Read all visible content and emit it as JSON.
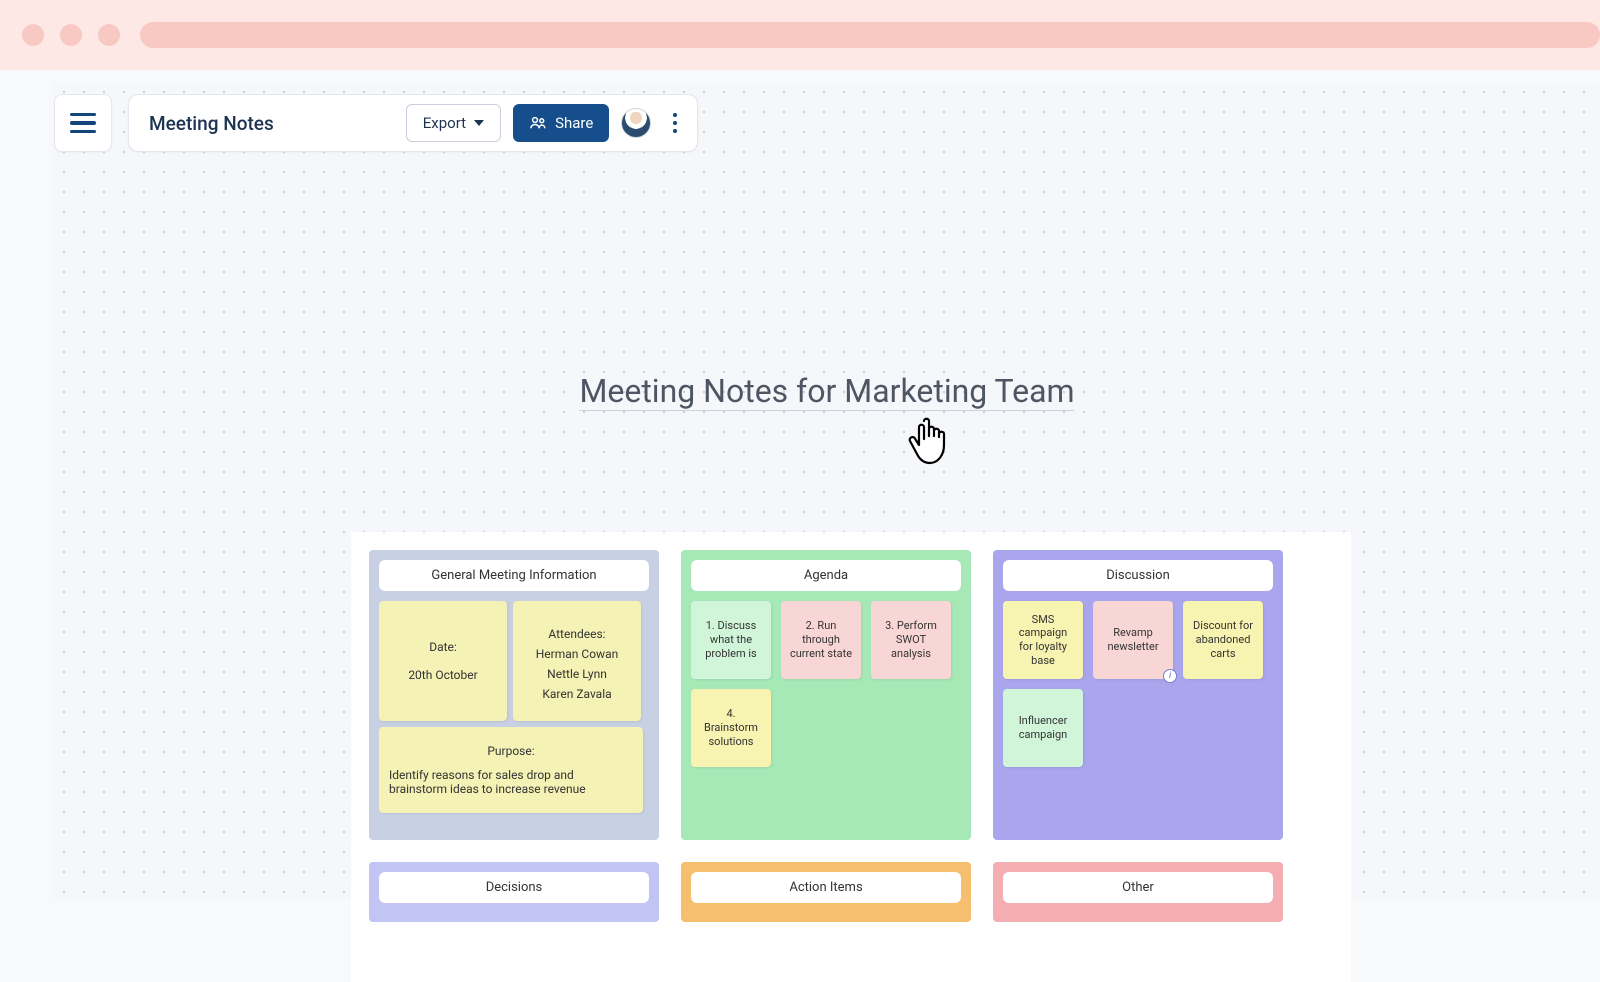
{
  "toolbar": {
    "doc_title": "Meeting Notes",
    "export_label": "Export",
    "share_label": "Share"
  },
  "board": {
    "title": "Meeting Notes for Marketing Team",
    "columns": {
      "general": {
        "header": "General Meeting Information",
        "date_label": "Date:",
        "date_value": "20th October",
        "attendees_label": "Attendees:",
        "attendees": [
          "Herman Cowan",
          "Nettle Lynn",
          "Karen Zavala"
        ],
        "purpose_label": "Purpose:",
        "purpose_text": "Identify reasons for sales drop and brainstorm ideas to increase revenue"
      },
      "agenda": {
        "header": "Agenda",
        "items": [
          "1. Discuss what the problem is",
          "2. Run through current state",
          "3. Perform SWOT analysis",
          "4. Brainstorm solutions"
        ]
      },
      "discussion": {
        "header": "Discussion",
        "items": [
          "SMS campaign for loyalty base",
          "Revamp newsletter",
          "Discount for abandoned carts",
          "Influencer campaign"
        ]
      },
      "decisions": {
        "header": "Decisions"
      },
      "actions": {
        "header": "Action Items"
      },
      "other": {
        "header": "Other"
      }
    }
  }
}
